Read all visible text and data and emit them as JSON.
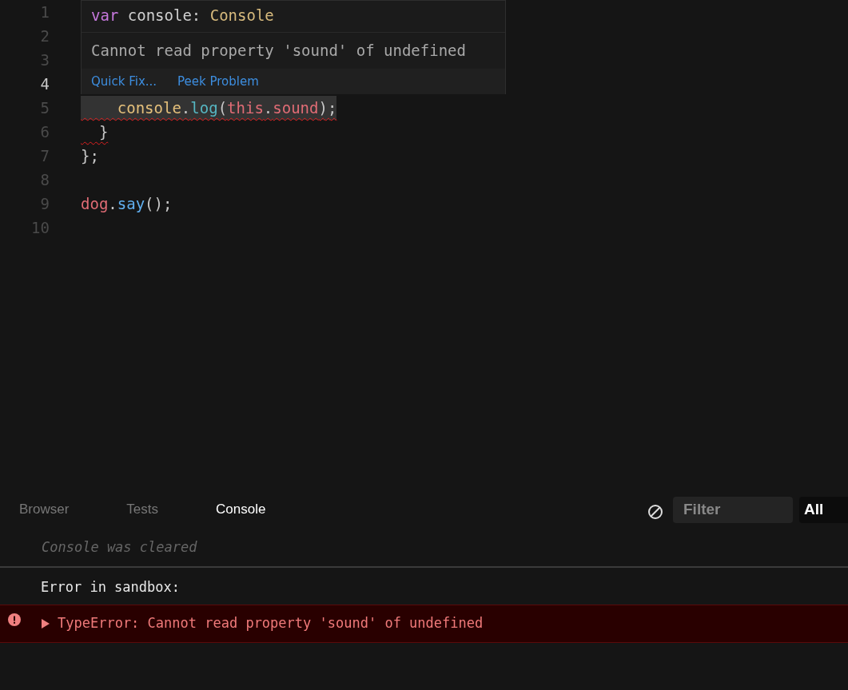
{
  "editor": {
    "lines": [
      {
        "number": "1",
        "current": false
      },
      {
        "number": "2",
        "current": false
      },
      {
        "number": "3",
        "current": false
      },
      {
        "number": "4",
        "current": true,
        "highlighted": false,
        "squiggle": false
      },
      {
        "number": "5",
        "current": false,
        "highlighted": true,
        "squiggle": true,
        "tokens": [
          {
            "kind": "variable",
            "text": "    console"
          },
          {
            "kind": "punct",
            "text": "."
          },
          {
            "kind": "method",
            "text": "log"
          },
          {
            "kind": "punct",
            "text": "("
          },
          {
            "kind": "keyword",
            "text": "this"
          },
          {
            "kind": "punct",
            "text": "."
          },
          {
            "kind": "property",
            "text": "sound"
          },
          {
            "kind": "punct",
            "text": ");"
          }
        ]
      },
      {
        "number": "6",
        "current": false,
        "highlighted": false,
        "squiggle": true,
        "tokens": [
          {
            "kind": "punct",
            "text": "  }"
          }
        ]
      },
      {
        "number": "7",
        "current": false,
        "highlighted": false,
        "squiggle": false,
        "tokens": [
          {
            "kind": "punct",
            "text": "};"
          }
        ]
      },
      {
        "number": "8",
        "current": false,
        "highlighted": false,
        "squiggle": false
      },
      {
        "number": "9",
        "current": false,
        "highlighted": false,
        "squiggle": false,
        "tokens": [
          {
            "kind": "property",
            "text": "dog"
          },
          {
            "kind": "punct",
            "text": "."
          },
          {
            "kind": "function",
            "text": "say"
          },
          {
            "kind": "punct",
            "text": "();"
          }
        ]
      },
      {
        "number": "10",
        "current": false,
        "highlighted": false,
        "squiggle": false
      }
    ]
  },
  "hover": {
    "signature": [
      {
        "kind": "declare",
        "text": "var"
      },
      {
        "kind": "plain",
        "text": " console"
      },
      {
        "kind": "punct",
        "text": ": "
      },
      {
        "kind": "type",
        "text": "Console"
      }
    ],
    "message": "Cannot read property 'sound' of undefined",
    "actions": [
      "Quick Fix...",
      "Peek Problem"
    ]
  },
  "panel": {
    "tabs": [
      {
        "label": "Browser",
        "selected": false
      },
      {
        "label": "Tests",
        "selected": false
      },
      {
        "label": "Console",
        "selected": true
      }
    ],
    "filter": {
      "placeholder": "Filter"
    },
    "level": "All",
    "messages": [
      {
        "kind": "info",
        "text": "Console was cleared"
      },
      {
        "kind": "log",
        "text": "Error in sandbox:"
      },
      {
        "kind": "error",
        "expanded": false,
        "text": "TypeError: Cannot read property 'sound' of undefined"
      }
    ]
  }
}
